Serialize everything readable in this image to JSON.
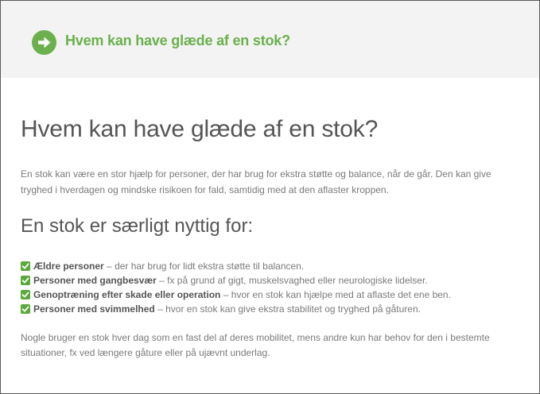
{
  "banner": {
    "icon": "arrow-right-circle-icon",
    "title": "Hvem kan have glæde af en stok?"
  },
  "article": {
    "heading": "Hvem kan have glæde af en stok?",
    "intro": "En stok kan være en stor hjælp for personer, der har brug for ekstra støtte og balance, når de går. Den kan give tryghed i hverdagen og mindske risikoen for fald, samtidig med at den aflaster kroppen.",
    "subheading": "En stok er særligt nyttig for:",
    "list": [
      {
        "term": "Ældre personer",
        "desc": "der har brug for lidt ekstra støtte til balancen."
      },
      {
        "term": "Personer med gangbesvær",
        "desc": "fx på grund af gigt, muskelsvaghed eller neurologiske lidelser."
      },
      {
        "term": "Genoptræning efter skade eller operation",
        "desc": "hvor en stok kan hjælpe med at aflaste det ene ben."
      },
      {
        "term": "Personer med svimmelhed",
        "desc": "hvor en stok kan give ekstra stabilitet og tryghed på gåturen."
      }
    ],
    "separator": "–",
    "outro": "Nogle bruger en stok hver dag som en fast del af deres mobilitet, mens andre kun har behov for den i bestemte situationer, fx ved længere gåture eller på ujævnt underlag."
  },
  "colors": {
    "accent_green": "#6ab04c",
    "check_green": "#5ba93a",
    "banner_bg": "#f3f3f3",
    "heading_text": "#555555",
    "body_text": "#7a7a7a"
  }
}
